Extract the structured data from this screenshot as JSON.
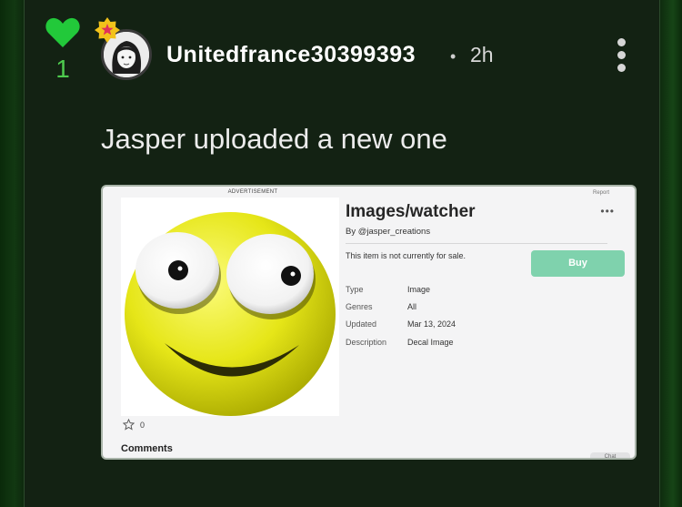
{
  "post": {
    "likes": "1",
    "username": "Unitedfrance30399393",
    "separator": "•",
    "time": "2h",
    "text": "Jasper uploaded a new one"
  },
  "screenshot": {
    "advertisement": "ADVERTISEMENT",
    "report": "Report",
    "title": "Images/watcher",
    "by": "By @jasper_creations",
    "menu": "•••",
    "sale_note": "This item is not currently for sale.",
    "buy_label": "Buy",
    "details": [
      {
        "key": "Type",
        "value": "Image"
      },
      {
        "key": "Genres",
        "value": "All"
      },
      {
        "key": "Updated",
        "value": "Mar 13, 2024"
      },
      {
        "key": "Description",
        "value": "Decal Image"
      }
    ],
    "favorites": "0",
    "comments_label": "Comments",
    "chat_label": "Chat"
  },
  "colors": {
    "like_green": "#4ecb4e",
    "badge_yellow": "#f2c21a",
    "badge_star": "#e0315a",
    "buy_button": "#7fd2ad"
  },
  "icons": [
    "heart-icon",
    "achievement-badge-icon",
    "more-options-icon",
    "star-icon"
  ]
}
